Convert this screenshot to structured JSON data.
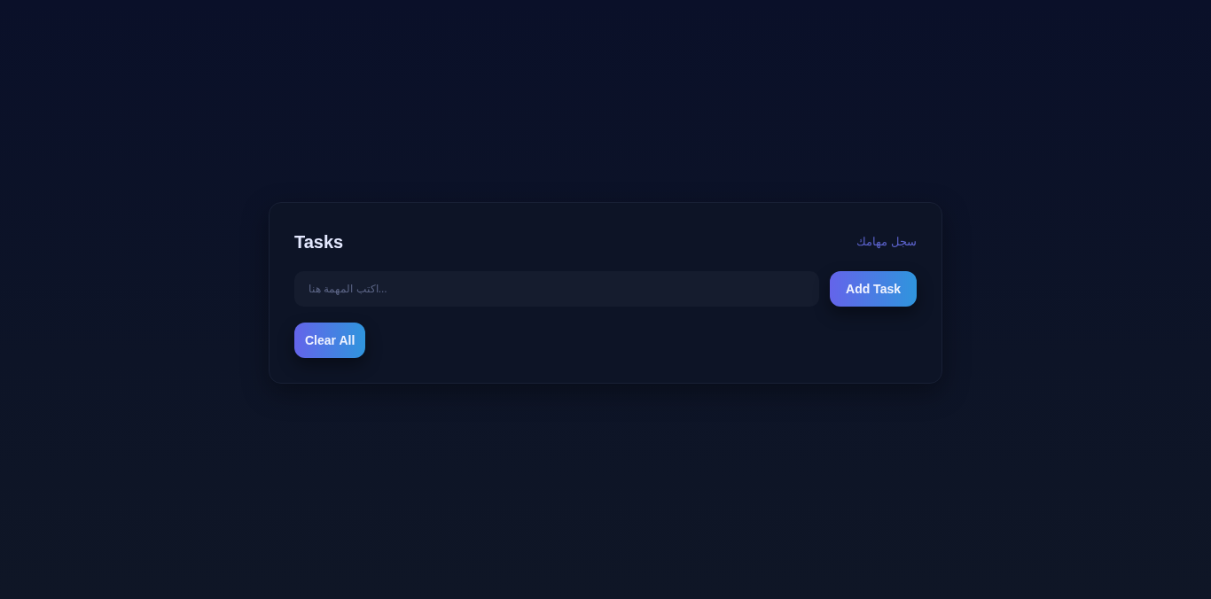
{
  "card": {
    "title": "Tasks",
    "subtitle": "سجل مهامك"
  },
  "task_input": {
    "placeholder": "اكتب المهمة هنا..."
  },
  "buttons": [
    {
      "kind": "add",
      "label": "Add Task"
    },
    {
      "kind": "clear",
      "label": "Clear All"
    }
  ]
}
